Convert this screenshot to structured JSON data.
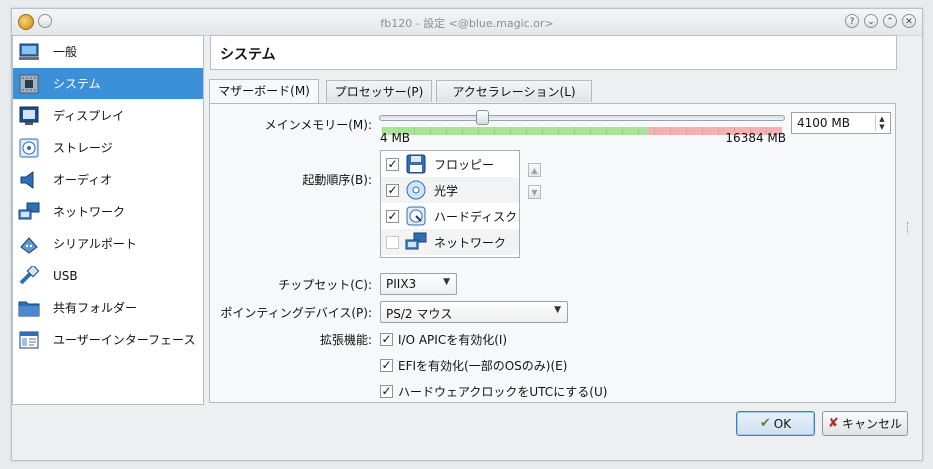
{
  "window": {
    "title": "fb120 - 設定 <@blue.magic.or>",
    "titlebar_buttons": [
      "?",
      "⌄",
      "⌃",
      "✕"
    ]
  },
  "sidebar": {
    "items": [
      {
        "label": "一般",
        "icon": "monitor-icon"
      },
      {
        "label": "システム",
        "icon": "chip-icon",
        "selected": true
      },
      {
        "label": "ディスプレイ",
        "icon": "display-icon"
      },
      {
        "label": "ストレージ",
        "icon": "disk-icon"
      },
      {
        "label": "オーディオ",
        "icon": "speaker-icon"
      },
      {
        "label": "ネットワーク",
        "icon": "network-icon"
      },
      {
        "label": "シリアルポート",
        "icon": "serial-port-icon"
      },
      {
        "label": "USB",
        "icon": "usb-icon"
      },
      {
        "label": "共有フォルダー",
        "icon": "folder-icon"
      },
      {
        "label": "ユーザーインターフェース",
        "icon": "ui-window-icon"
      }
    ]
  },
  "main": {
    "title": "システム",
    "tabs": [
      "マザーボード(M)",
      "プロセッサー(P)",
      "アクセラレーション(L)"
    ],
    "active_tab": 0,
    "memory": {
      "label": "メインメモリー(M):",
      "value": "4100 MB",
      "min_label": "4 MB",
      "max_label": "16384 MB",
      "min": 4,
      "max": 16384,
      "current": 4100
    },
    "boot_order": {
      "label": "起動順序(B):",
      "items": [
        {
          "label": "フロッピー",
          "checked": true,
          "icon": "floppy-icon"
        },
        {
          "label": "光学",
          "checked": true,
          "icon": "optical-disc-icon"
        },
        {
          "label": "ハードディスク",
          "checked": true,
          "icon": "hard-disk-icon"
        },
        {
          "label": "ネットワーク",
          "checked": false,
          "icon": "network-icon"
        }
      ]
    },
    "chipset": {
      "label": "チップセット(C):",
      "value": "PIIX3"
    },
    "pointing": {
      "label": "ポインティングデバイス(P):",
      "value": "PS/2 マウス"
    },
    "extended": {
      "label": "拡張機能:",
      "options": [
        {
          "label": "I/O APICを有効化(I)",
          "checked": true
        },
        {
          "label": "EFIを有効化(一部のOSのみ)(E)",
          "checked": true
        },
        {
          "label": "ハードウェアクロックをUTCにする(U)",
          "checked": true
        }
      ]
    }
  },
  "buttons": {
    "ok": "OK",
    "cancel": "キャンセル"
  },
  "colors": {
    "selection": "#3b90d8",
    "scale_green": "#9be08a",
    "scale_red": "#f2a5a5"
  }
}
